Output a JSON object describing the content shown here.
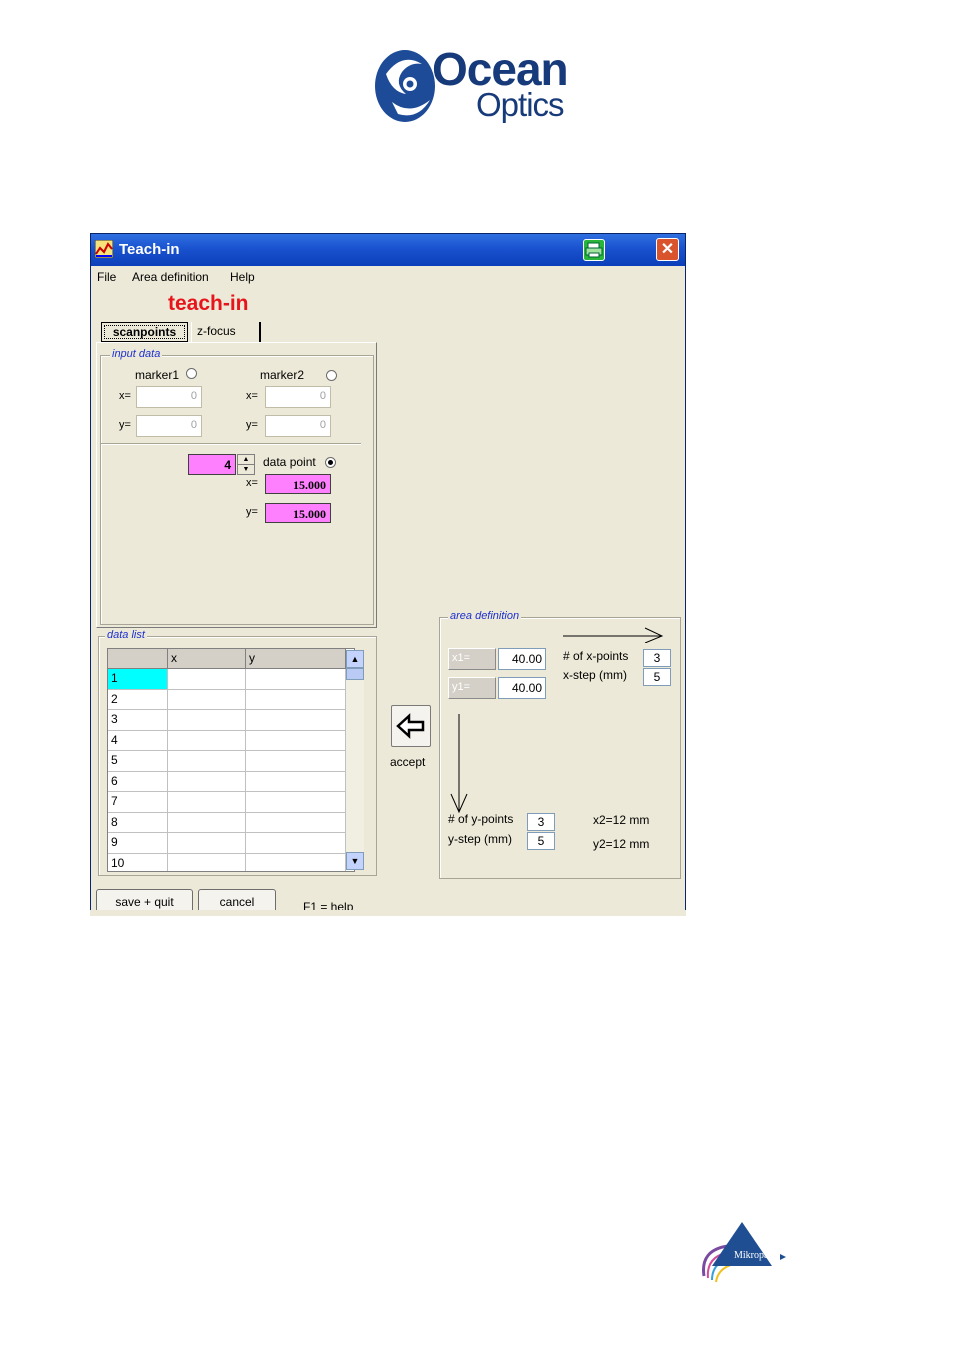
{
  "logo": {
    "line1": "Ocean",
    "line2": "Optics"
  },
  "window": {
    "title": "Teach-in",
    "close_glyph": "✕",
    "menu": [
      "File",
      "Area definition",
      "Help"
    ],
    "heading": "teach-in",
    "tabs": [
      "scanpoints",
      "z-focus"
    ]
  },
  "input_data": {
    "label": "input data",
    "marker1": "marker1",
    "marker2": "marker2",
    "x_label": "x=",
    "y_label": "y=",
    "marker1_x": "0",
    "marker1_y": "0",
    "marker2_x": "0",
    "marker2_y": "0",
    "data_point_value": "4",
    "data_point_label": "data point",
    "dp_x": "15.000",
    "dp_y": "15.000"
  },
  "data_list": {
    "label": "data list",
    "columns": [
      "",
      "x",
      "y"
    ],
    "rows": [
      "1",
      "2",
      "3",
      "4",
      "5",
      "6",
      "7",
      "8",
      "9",
      "10"
    ]
  },
  "accept": {
    "label": "accept"
  },
  "area_definition": {
    "label": "area definition",
    "x1_label": "x1=",
    "y1_label": "y1=",
    "x1_value": "40.00",
    "y1_value": "40.00",
    "x_points_label": "# of x-points",
    "x_points": "3",
    "x_step_label": "x-step (mm)",
    "x_step": "5",
    "y_points_label": "# of y-points",
    "y_points": "3",
    "y_step_label": "y-step (mm)",
    "y_step": "5",
    "x2": "x2=12 mm",
    "y2": "y2=12 mm"
  },
  "footer": {
    "save": "save + quit",
    "cancel": "cancel",
    "help": "F1 = help"
  },
  "brand_footer": "Mikropack",
  "colors": {
    "titlebar": "#1a52cf",
    "heading": "#e8141b",
    "pink_field": "#ff80ff",
    "selected_row": "#00ffff",
    "group_label": "#1d2fd0"
  }
}
